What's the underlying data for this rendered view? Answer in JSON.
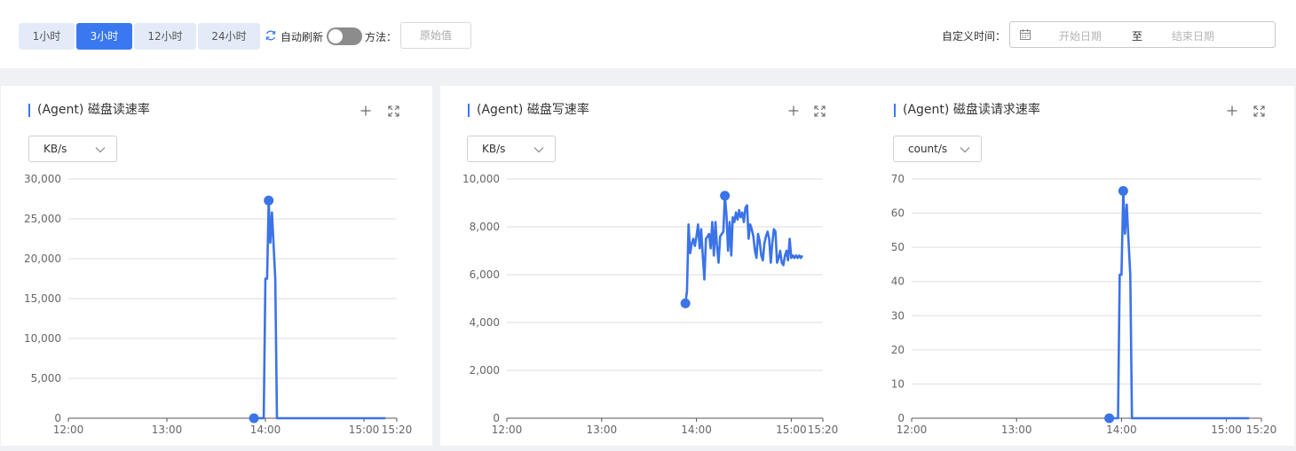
{
  "toolbar": {
    "ranges": [
      {
        "label": "1小时",
        "active": false
      },
      {
        "label": "3小时",
        "active": true
      },
      {
        "label": "12小时",
        "active": false
      },
      {
        "label": "24小时",
        "active": false
      }
    ],
    "refresh_icon": "refresh-icon",
    "auto_refresh_label": "自动刷新",
    "auto_refresh_on": false,
    "method_label": "方法：",
    "method_value": "原始值",
    "custom_time_label": "自定义时间：",
    "calendar_icon": "calendar-icon",
    "start_placeholder": "开始日期",
    "range_separator": "至",
    "end_placeholder": "结束日期"
  },
  "colors": {
    "accent": "#3a78f2",
    "series": "#3b73e8"
  },
  "panels": [
    {
      "title": "(Agent) 磁盘读速率",
      "unit": "KB/s",
      "icons": [
        "plus-icon",
        "expand-icon"
      ],
      "chart_data": {
        "type": "line",
        "xlim": [
          "12:00",
          "15:20"
        ],
        "xticks": [
          "12:00",
          "13:00",
          "14:00",
          "15:00",
          "15:20"
        ],
        "ylim": [
          0,
          30000
        ],
        "yticks": [
          "0",
          "5,000",
          "10,000",
          "15,000",
          "20,000",
          "25,000",
          "30,000"
        ],
        "grid": true,
        "series": [
          {
            "x": [
              "13:53",
              "13:56",
              "13:59",
              "14:00",
              "14:01",
              "14:02",
              "14:03",
              "14:04",
              "14:05",
              "14:06",
              "14:07",
              "14:08",
              "14:10",
              "14:20",
              "14:40",
              "15:00",
              "15:10",
              "15:13"
            ],
            "y": [
              0,
              0,
              0,
              17500,
              17500,
              27300,
              22000,
              25800,
              21500,
              17500,
              0,
              0,
              0,
              0,
              0,
              0,
              0,
              0
            ]
          }
        ],
        "markers": [
          {
            "x": "13:53",
            "y": 0
          },
          {
            "x": "14:02",
            "y": 27300
          }
        ]
      }
    },
    {
      "title": "(Agent) 磁盘写速率",
      "unit": "KB/s",
      "icons": [
        "plus-icon",
        "expand-icon"
      ],
      "chart_data": {
        "type": "line",
        "xlim": [
          "12:00",
          "15:20"
        ],
        "xticks": [
          "12:00",
          "13:00",
          "14:00",
          "15:00",
          "15:20"
        ],
        "ylim": [
          0,
          10000
        ],
        "yticks": [
          "0",
          "2,000",
          "4,000",
          "6,000",
          "8,000",
          "10,000"
        ],
        "grid": true,
        "series": [
          {
            "x": [
              "13:53",
              "13:54",
              "13:55",
              "13:56",
              "13:57",
              "13:58",
              "13:59",
              "14:00",
              "14:01",
              "14:02",
              "14:03",
              "14:04",
              "14:05",
              "14:06",
              "14:07",
              "14:08",
              "14:09",
              "14:10",
              "14:11",
              "14:12",
              "14:13",
              "14:14",
              "14:15",
              "14:16",
              "14:17",
              "14:18",
              "14:19",
              "14:20",
              "14:21",
              "14:22",
              "14:23",
              "14:24",
              "14:25",
              "14:26",
              "14:27",
              "14:28",
              "14:29",
              "14:30",
              "14:31",
              "14:32",
              "14:33",
              "14:34",
              "14:35",
              "14:36",
              "14:37",
              "14:38",
              "14:39",
              "14:40",
              "14:41",
              "14:42",
              "14:43",
              "14:44",
              "14:45",
              "14:46",
              "14:47",
              "14:48",
              "14:49",
              "14:50",
              "14:51",
              "14:52",
              "14:53",
              "14:54",
              "14:55",
              "14:56",
              "14:57",
              "14:58",
              "14:59",
              "15:00",
              "15:01",
              "15:02",
              "15:03",
              "15:04",
              "15:05",
              "15:06",
              "15:07"
            ],
            "y": [
              4800,
              5300,
              8100,
              6900,
              7300,
              7500,
              7200,
              7600,
              8100,
              7100,
              7900,
              6800,
              5800,
              7500,
              7600,
              7700,
              7100,
              8200,
              6800,
              8200,
              7200,
              6500,
              7600,
              7700,
              7800,
              9300,
              8500,
              7000,
              8200,
              6800,
              8400,
              8200,
              8600,
              8300,
              8700,
              8400,
              8600,
              8200,
              8800,
              8900,
              7500,
              8100,
              7900,
              7600,
              7000,
              6700,
              7700,
              7400,
              6800,
              6600,
              7300,
              7600,
              7800,
              7500,
              6500,
              7300,
              7900,
              7800,
              6500,
              6700,
              7000,
              6500,
              6400,
              6800,
              7000,
              6600,
              7500,
              6700,
              6800,
              6700,
              6800,
              6700,
              6800,
              6700,
              6800
            ],
            "note": ""
          }
        ],
        "markers": [
          {
            "x": "13:53",
            "y": 4800
          },
          {
            "x": "14:18",
            "y": 9300
          }
        ]
      }
    },
    {
      "title": "(Agent) 磁盘读请求速率",
      "unit": "count/s",
      "icons": [
        "plus-icon",
        "expand-icon"
      ],
      "chart_data": {
        "type": "line",
        "xlim": [
          "12:00",
          "15:20"
        ],
        "xticks": [
          "12:00",
          "13:00",
          "14:00",
          "15:00",
          "15:20"
        ],
        "ylim": [
          0,
          70
        ],
        "yticks": [
          "0",
          "10",
          "20",
          "30",
          "40",
          "50",
          "60",
          "70"
        ],
        "grid": true,
        "series": [
          {
            "x": [
              "13:53",
              "13:56",
              "13:58",
              "13:59",
              "14:00",
              "14:01",
              "14:02",
              "14:03",
              "14:04",
              "14:05",
              "14:06",
              "14:07",
              "14:10",
              "14:20",
              "14:40",
              "15:00",
              "15:10",
              "15:13"
            ],
            "y": [
              0,
              0,
              0,
              42,
              42,
              66.5,
              54,
              62.5,
              52,
              42,
              0,
              0,
              0,
              0,
              0,
              0,
              0,
              0
            ]
          }
        ],
        "markers": [
          {
            "x": "13:53",
            "y": 0
          },
          {
            "x": "14:01",
            "y": 66.5
          }
        ]
      }
    }
  ]
}
